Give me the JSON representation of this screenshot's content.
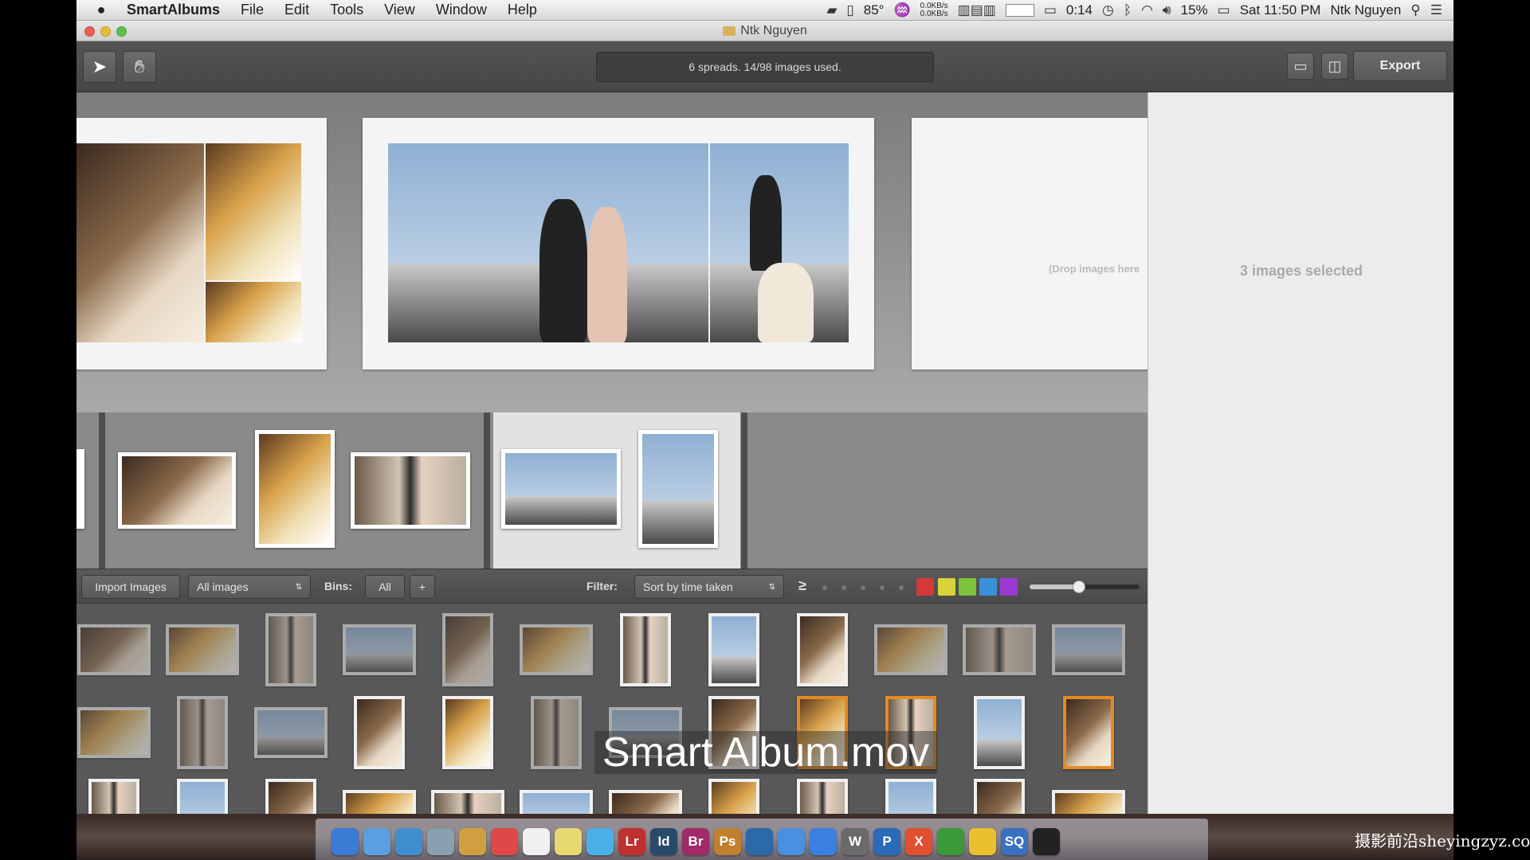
{
  "menubar": {
    "app_name": "SmartAlbums",
    "menus": [
      "File",
      "Edit",
      "Tools",
      "View",
      "Window",
      "Help"
    ],
    "temperature": "85°",
    "net_up": "0.0KB/s",
    "net_down": "0.0KB/s",
    "timer": "0:14",
    "battery": "15%",
    "clock": "Sat 11:50 PM",
    "user": "Ntk  Nguyen"
  },
  "window": {
    "title": "Ntk Nguyen"
  },
  "toolbar": {
    "status_text": "6 spreads. 14/98 images used.",
    "export_label": "Export"
  },
  "spread_area": {
    "drop_hint": "(Drop images here"
  },
  "side_panel": {
    "message": "3 images selected"
  },
  "filter_bar": {
    "import_label": "Import Images",
    "source_select": "All images",
    "bins_label": "Bins:",
    "bins_all": "All",
    "bins_add": "+",
    "filter_label": "Filter:",
    "sort_select": "Sort by time taken",
    "rating_symbol": "≥",
    "color_labels": [
      "#d43a3a",
      "#d9d23a",
      "#7cc23a",
      "#3a8fd9",
      "#9a3ad0"
    ],
    "thumb_size": 0.45
  },
  "overlay": {
    "caption": "Smart Album.mov"
  },
  "dock": {
    "icons": [
      "Lr",
      "Id",
      "Br",
      "Ps",
      "W",
      "P",
      "X",
      "SQ"
    ]
  },
  "watermark": "摄影前沿sheyingzyz.com"
}
